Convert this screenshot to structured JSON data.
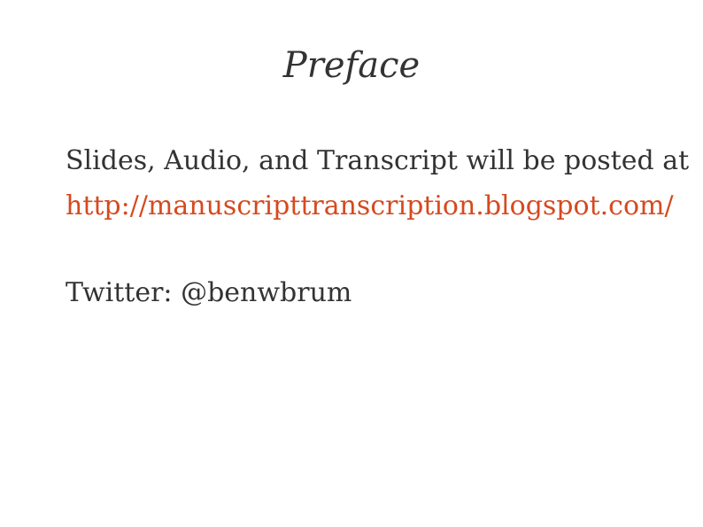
{
  "slide": {
    "title": "Preface",
    "intro_text": "Slides, Audio, and Transcript will be posted at",
    "link_text": "http://manuscripttranscription.blogspot.com/",
    "twitter_text": "Twitter: @benwbrum"
  },
  "colors": {
    "text": "#333333",
    "link": "#d54a1f",
    "background": "#ffffff"
  }
}
